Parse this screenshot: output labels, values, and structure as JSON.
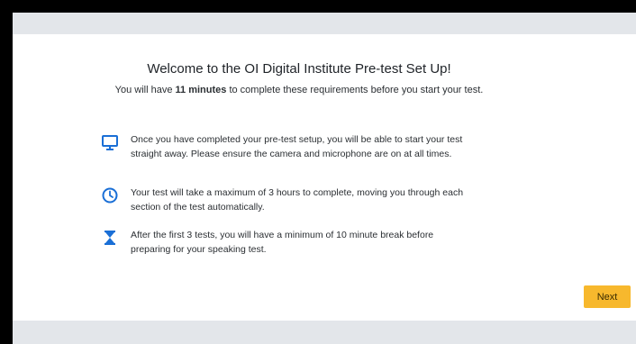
{
  "welcome": {
    "title": "Welcome to the OI Digital Institute Pre-test Set Up!",
    "intro_prefix": "You will have ",
    "intro_time": "11 minutes",
    "intro_suffix": " to complete these requirements before you start your test."
  },
  "info_items": [
    {
      "icon": "monitor-icon",
      "text": "Once you have completed your pre-test setup, you will be able to start your test straight away. Please ensure the camera and microphone are on at all times."
    },
    {
      "icon": "clock-icon",
      "text": "Your test will take a maximum of 3 hours to complete, moving you through each section of the test automatically."
    },
    {
      "icon": "hourglass-icon",
      "text": "After the first 3 tests, you will have a minimum of 10 minute break before preparing for your speaking test."
    }
  ],
  "actions": {
    "next_label": "Next"
  },
  "colors": {
    "accent_icon": "#1a6fd6",
    "button": "#f7b82d",
    "bar": "#e3e6ea"
  }
}
